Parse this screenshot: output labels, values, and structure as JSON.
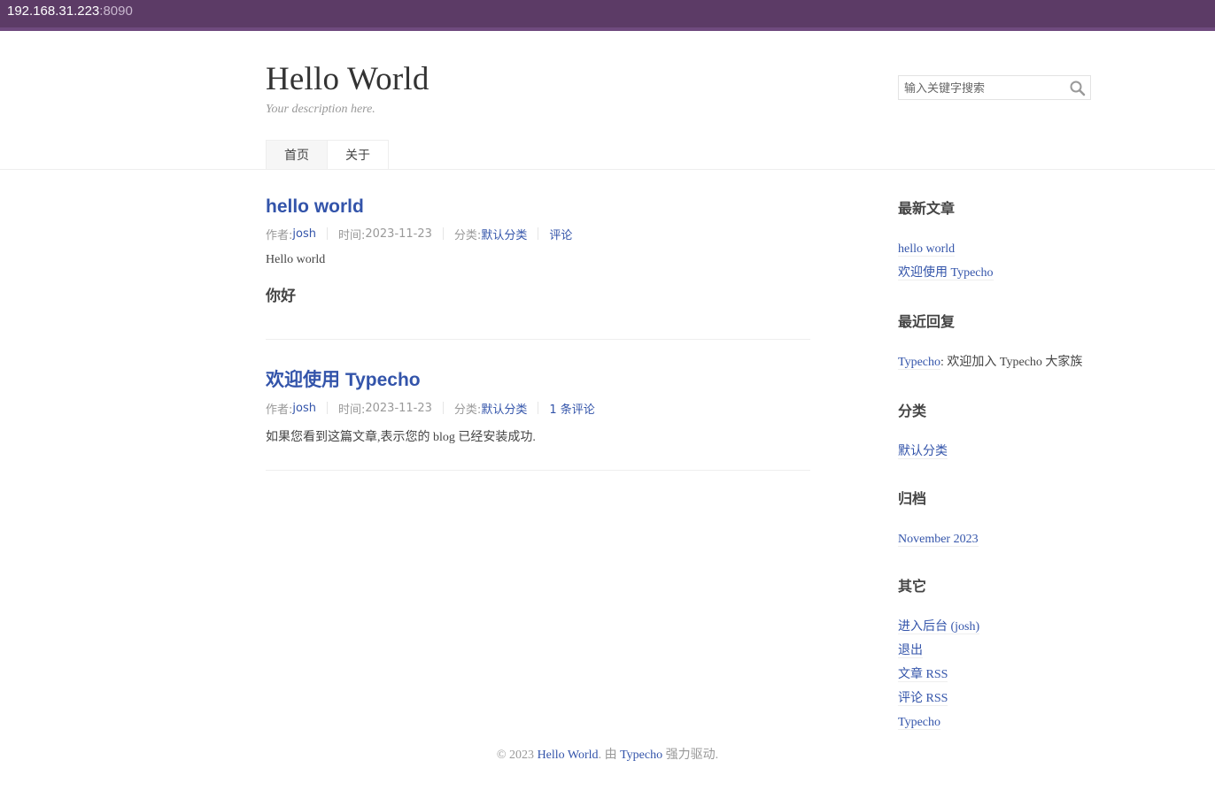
{
  "browser": {
    "url_host": "192.168.31.223",
    "url_port": ":8090"
  },
  "site": {
    "title": "Hello World",
    "description": "Your description here."
  },
  "search": {
    "placeholder": "输入关键字搜索"
  },
  "nav": {
    "items": [
      {
        "label": "首页",
        "active": true
      },
      {
        "label": "关于",
        "active": false
      }
    ]
  },
  "posts": [
    {
      "title": "hello world",
      "author_label": "作者: ",
      "author": "josh",
      "date_label": "时间: ",
      "date": "2023-11-23",
      "category_label": "分类: ",
      "category": "默认分类",
      "comments": "评论",
      "content_text": "Hello world",
      "content_heading": "你好"
    },
    {
      "title": "欢迎使用 Typecho",
      "author_label": "作者: ",
      "author": "josh",
      "date_label": "时间: ",
      "date": "2023-11-23",
      "category_label": "分类: ",
      "category": "默认分类",
      "comments": "1 条评论",
      "content_text": "如果您看到这篇文章,表示您的 blog 已经安装成功."
    }
  ],
  "sidebar": {
    "recent_posts": {
      "title": "最新文章",
      "items": [
        "hello world",
        "欢迎使用 Typecho"
      ]
    },
    "recent_comments": {
      "title": "最近回复",
      "author": "Typecho",
      "text": ": 欢迎加入 Typecho 大家族"
    },
    "categories": {
      "title": "分类",
      "items": [
        "默认分类"
      ]
    },
    "archives": {
      "title": "归档",
      "items": [
        "November 2023"
      ]
    },
    "other": {
      "title": "其它",
      "items": [
        "进入后台 (josh)",
        "退出",
        "文章 RSS",
        "评论 RSS",
        "Typecho"
      ]
    }
  },
  "footer": {
    "prefix": "© 2023 ",
    "site_link": "Hello World",
    "middle": ". 由 ",
    "typecho_link": "Typecho",
    "suffix": " 强力驱动."
  },
  "icons": {
    "search": "search-icon"
  },
  "colors": {
    "link": "#3354AA",
    "urlbar": "#5c3b66"
  }
}
